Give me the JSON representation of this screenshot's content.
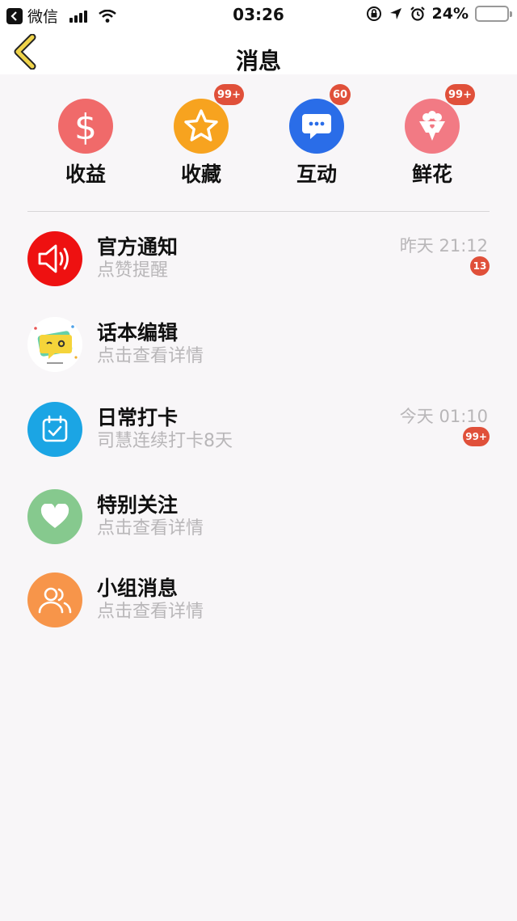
{
  "status_bar": {
    "app_name": "微信",
    "time": "03:26",
    "battery": "24%",
    "battery_level": 0.24
  },
  "nav": {
    "title": "消息"
  },
  "shortcuts": [
    {
      "label": "收益",
      "icon": "dollar-icon",
      "color": "#f06a6a",
      "badge": ""
    },
    {
      "label": "收藏",
      "icon": "star-icon",
      "color": "#f7a31f",
      "badge": "99+"
    },
    {
      "label": "互动",
      "icon": "chat-bubble-icon",
      "color": "#2a6de8",
      "badge": "60"
    },
    {
      "label": "鲜花",
      "icon": "flower-bouquet-icon",
      "color": "#f27a84",
      "badge": "99+"
    }
  ],
  "messages": [
    {
      "title": "官方通知",
      "subtitle": "点赞提醒",
      "time": "昨天 21:12",
      "badge": "13",
      "icon": "speaker-icon",
      "color": "#ee1111"
    },
    {
      "title": "话本编辑",
      "subtitle": "点击查看详情",
      "time": "",
      "badge": "",
      "icon": "editor-avatar-icon",
      "color": "#ffffff"
    },
    {
      "title": "日常打卡",
      "subtitle": "司慧连续打卡8天",
      "time": "今天 01:10",
      "badge": "99+",
      "icon": "calendar-check-icon",
      "color": "#1ba5e4"
    },
    {
      "title": "特别关注",
      "subtitle": "点击查看详情",
      "time": "",
      "badge": "",
      "icon": "heart-icon",
      "color": "#86c98e"
    },
    {
      "title": "小组消息",
      "subtitle": "点击查看详情",
      "time": "",
      "badge": "",
      "icon": "group-users-icon",
      "color": "#f7954a"
    }
  ]
}
